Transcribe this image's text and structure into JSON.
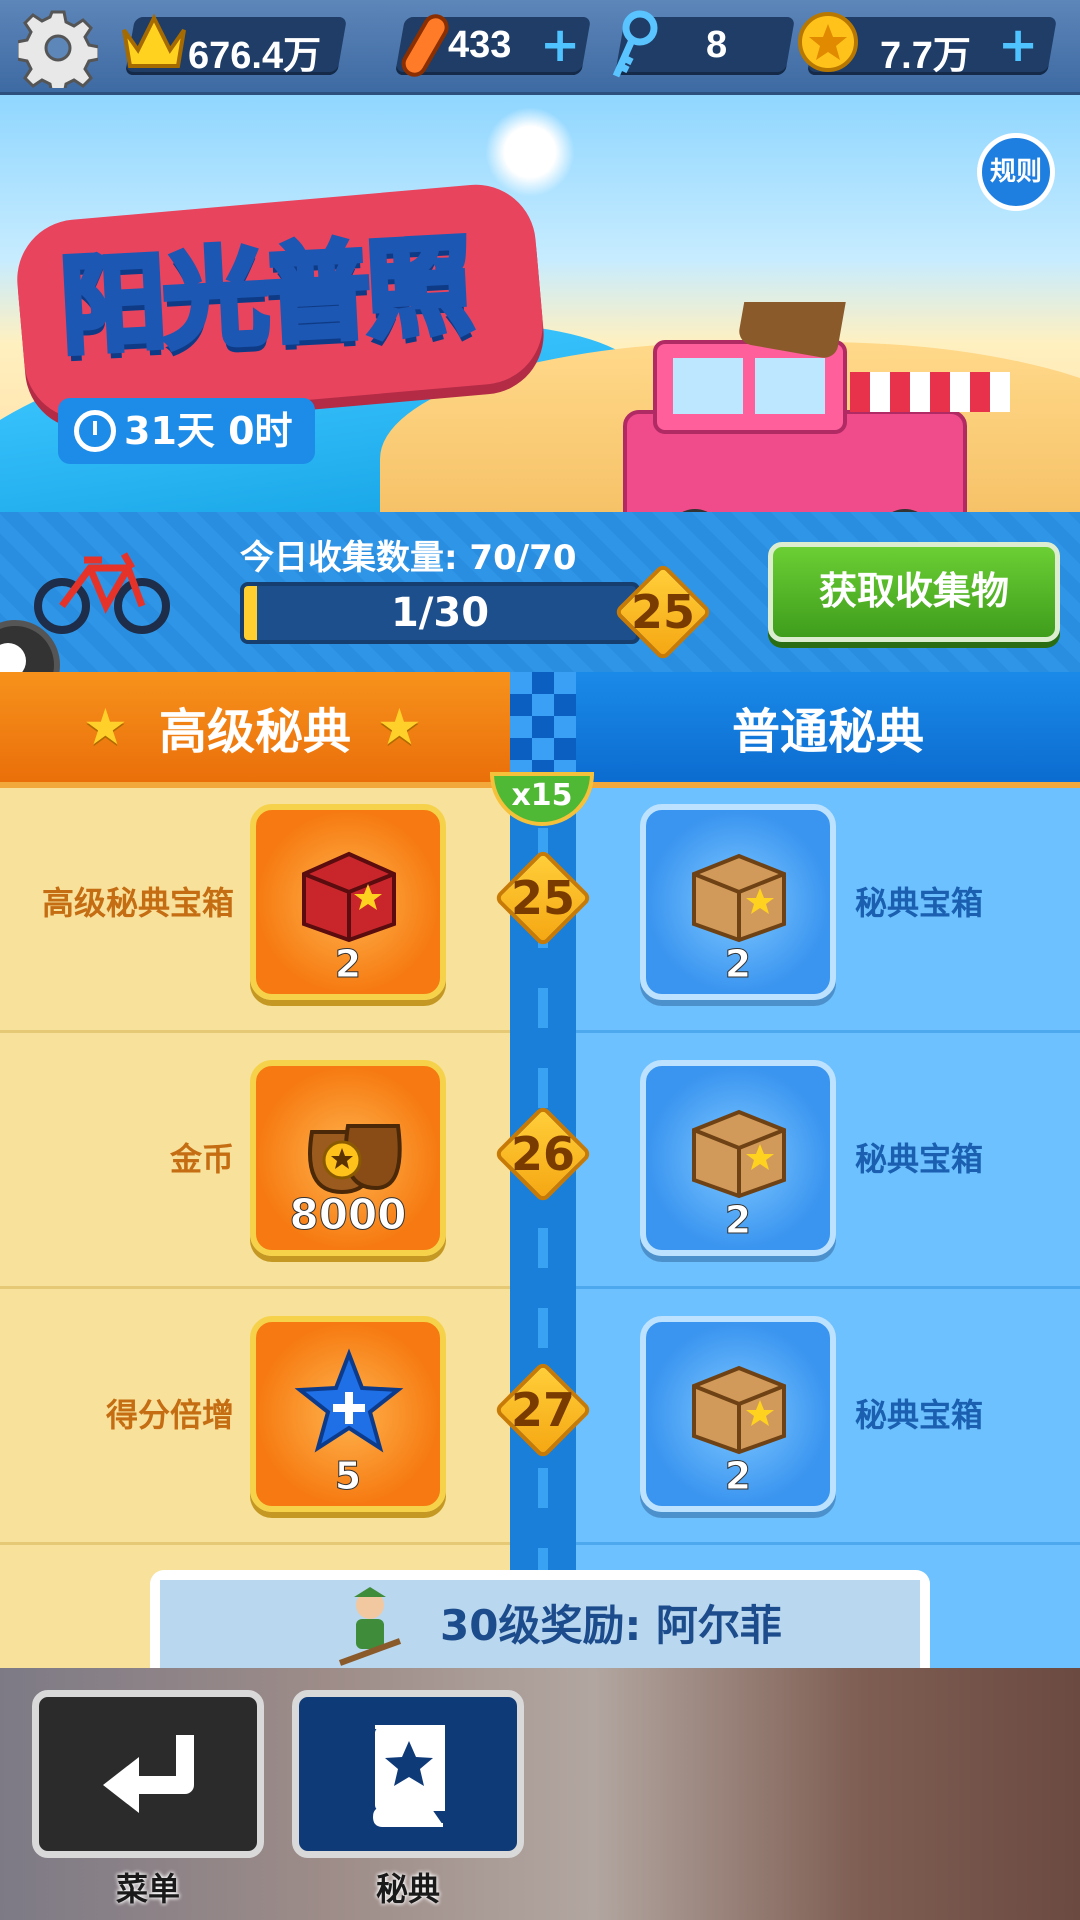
{
  "topbar": {
    "score": "676.4万",
    "boards": "433",
    "keys": "8",
    "coins": "7.7万",
    "plus": "+"
  },
  "banner": {
    "title": "阳光普照",
    "timer": "31天 0时",
    "rules": "规则"
  },
  "collect": {
    "label": "今日收集数量: 70/70",
    "progress_text": "1/30",
    "progress_fraction": 0.0333,
    "level": "25",
    "button": "获取收集物"
  },
  "tabs": {
    "premium": "高级秘典",
    "normal": "普通秘典"
  },
  "track": {
    "multiplier": "x15",
    "rows": [
      {
        "level": "25",
        "premium_label": "高级秘典宝箱",
        "premium_count": "2",
        "premium_icon": "red-chest-icon",
        "normal_label": "秘典宝箱",
        "normal_count": "2",
        "normal_icon": "wooden-box-icon"
      },
      {
        "level": "26",
        "premium_label": "金币",
        "premium_count": "8000",
        "premium_icon": "coin-bag-icon",
        "normal_label": "秘典宝箱",
        "normal_count": "2",
        "normal_icon": "wooden-box-icon"
      },
      {
        "level": "27",
        "premium_label": "得分倍增",
        "premium_count": "5",
        "premium_icon": "blue-star-plus-icon",
        "normal_label": "秘典宝箱",
        "normal_count": "2",
        "normal_icon": "wooden-box-icon"
      }
    ]
  },
  "reward": {
    "text": "30级奖励: 阿尔菲"
  },
  "bottom": {
    "menu": "菜单",
    "book": "秘典"
  },
  "colors": {
    "premium_orange": "#f7921c",
    "normal_blue": "#1a8ae8",
    "get_button_green": "#4fb834",
    "diamond_gold": "#ffcf3a"
  }
}
